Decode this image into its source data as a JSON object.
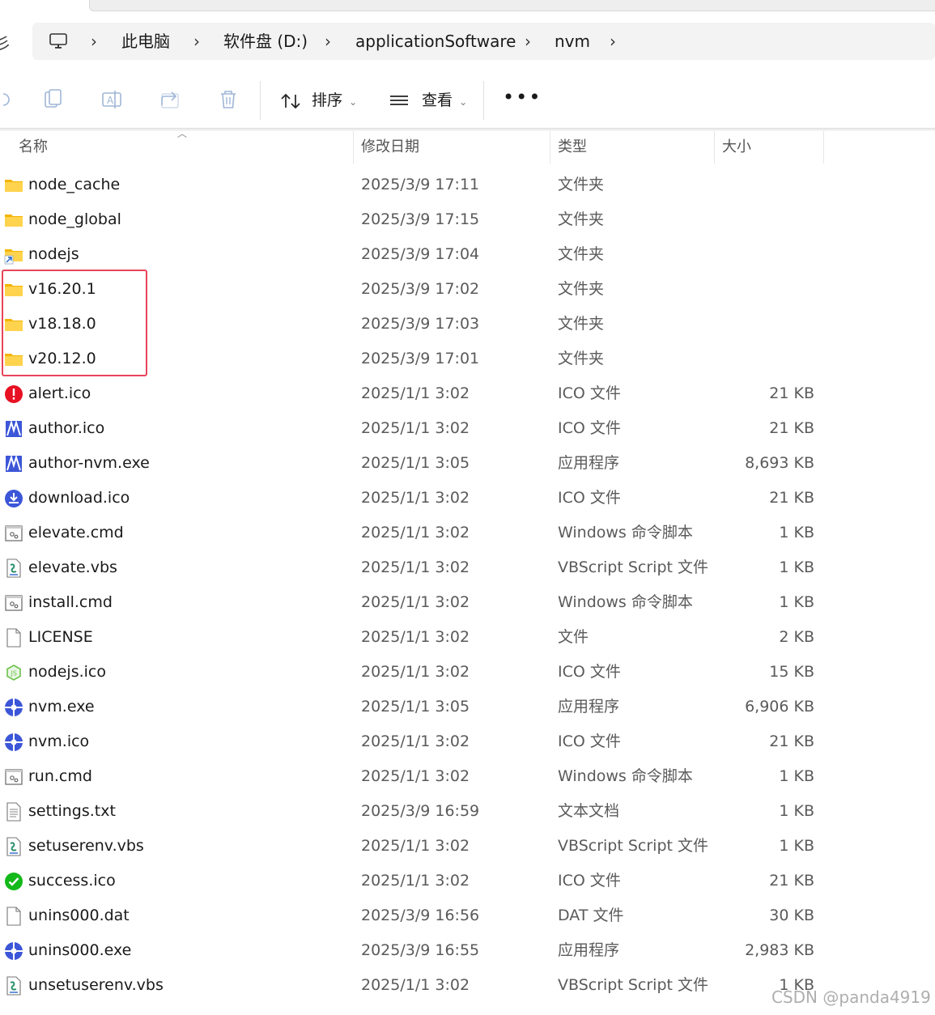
{
  "breadcrumb": {
    "items": [
      "此电脑",
      "软件盘 (D:)",
      "applicationSoftware",
      "nvm"
    ]
  },
  "toolbar": {
    "sort_label": "排序",
    "view_label": "查看"
  },
  "columns": {
    "name": "名称",
    "date": "修改日期",
    "type": "类型",
    "size": "大小"
  },
  "files": [
    {
      "name": "node_cache",
      "date": "2025/3/9 17:11",
      "type": "文件夹",
      "size": "",
      "icon": "folder-icon"
    },
    {
      "name": "node_global",
      "date": "2025/3/9 17:15",
      "type": "文件夹",
      "size": "",
      "icon": "folder-icon"
    },
    {
      "name": "nodejs",
      "date": "2025/3/9 17:04",
      "type": "文件夹",
      "size": "",
      "icon": "folder-shortcut-icon"
    },
    {
      "name": "v16.20.1",
      "date": "2025/3/9 17:02",
      "type": "文件夹",
      "size": "",
      "icon": "folder-icon"
    },
    {
      "name": "v18.18.0",
      "date": "2025/3/9 17:03",
      "type": "文件夹",
      "size": "",
      "icon": "folder-icon"
    },
    {
      "name": "v20.12.0",
      "date": "2025/3/9 17:01",
      "type": "文件夹",
      "size": "",
      "icon": "folder-icon"
    },
    {
      "name": "alert.ico",
      "date": "2025/1/1 3:02",
      "type": "ICO 文件",
      "size": "21 KB",
      "icon": "alert-icon"
    },
    {
      "name": "author.ico",
      "date": "2025/1/1 3:02",
      "type": "ICO 文件",
      "size": "21 KB",
      "icon": "author-icon"
    },
    {
      "name": "author-nvm.exe",
      "date": "2025/1/1 3:05",
      "type": "应用程序",
      "size": "8,693 KB",
      "icon": "author-icon"
    },
    {
      "name": "download.ico",
      "date": "2025/1/1 3:02",
      "type": "ICO 文件",
      "size": "21 KB",
      "icon": "download-icon"
    },
    {
      "name": "elevate.cmd",
      "date": "2025/1/1 3:02",
      "type": "Windows 命令脚本",
      "size": "1 KB",
      "icon": "cmd-file-icon"
    },
    {
      "name": "elevate.vbs",
      "date": "2025/1/1 3:02",
      "type": "VBScript Script 文件",
      "size": "1 KB",
      "icon": "vbs-file-icon"
    },
    {
      "name": "install.cmd",
      "date": "2025/1/1 3:02",
      "type": "Windows 命令脚本",
      "size": "1 KB",
      "icon": "cmd-file-icon"
    },
    {
      "name": "LICENSE",
      "date": "2025/1/1 3:02",
      "type": "文件",
      "size": "2 KB",
      "icon": "blank-file-icon"
    },
    {
      "name": "nodejs.ico",
      "date": "2025/1/1 3:02",
      "type": "ICO 文件",
      "size": "15 KB",
      "icon": "nodejs-icon"
    },
    {
      "name": "nvm.exe",
      "date": "2025/1/1 3:05",
      "type": "应用程序",
      "size": "6,906 KB",
      "icon": "nvm-icon"
    },
    {
      "name": "nvm.ico",
      "date": "2025/1/1 3:02",
      "type": "ICO 文件",
      "size": "21 KB",
      "icon": "nvm-icon"
    },
    {
      "name": "run.cmd",
      "date": "2025/1/1 3:02",
      "type": "Windows 命令脚本",
      "size": "1 KB",
      "icon": "cmd-file-icon"
    },
    {
      "name": "settings.txt",
      "date": "2025/3/9 16:59",
      "type": "文本文档",
      "size": "1 KB",
      "icon": "text-file-icon"
    },
    {
      "name": "setuserenv.vbs",
      "date": "2025/1/1 3:02",
      "type": "VBScript Script 文件",
      "size": "1 KB",
      "icon": "vbs-file-icon"
    },
    {
      "name": "success.ico",
      "date": "2025/1/1 3:02",
      "type": "ICO 文件",
      "size": "21 KB",
      "icon": "success-icon"
    },
    {
      "name": "unins000.dat",
      "date": "2025/3/9 16:56",
      "type": "DAT 文件",
      "size": "30 KB",
      "icon": "blank-file-icon"
    },
    {
      "name": "unins000.exe",
      "date": "2025/3/9 16:55",
      "type": "应用程序",
      "size": "2,983 KB",
      "icon": "nvm-icon"
    },
    {
      "name": "unsetuserenv.vbs",
      "date": "2025/1/1 3:02",
      "type": "VBScript Script 文件",
      "size": "1 KB",
      "icon": "vbs-file-icon"
    }
  ],
  "watermark": "CSDN @panda4919",
  "colors": {
    "highlight_border": "#e8445a",
    "folder_yellow": "#f7c948",
    "nvm_blue": "#3c56d8",
    "alert_red": "#e81123",
    "success_green": "#13b91a"
  }
}
